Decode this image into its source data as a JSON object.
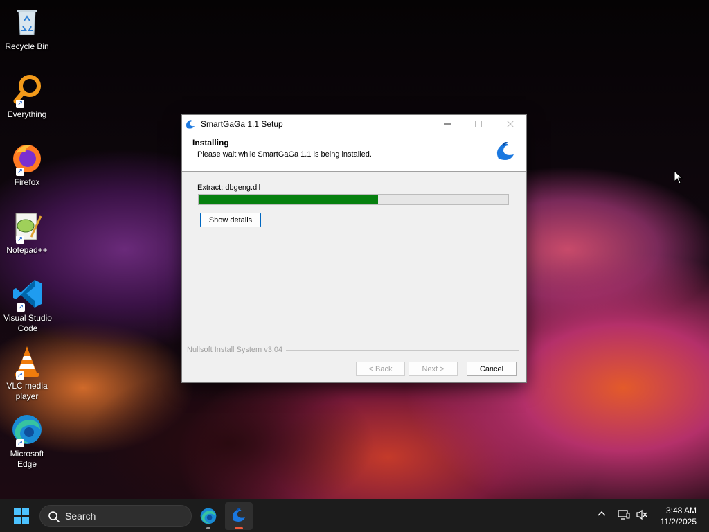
{
  "desktop": {
    "icons": [
      {
        "label": "Recycle Bin",
        "icon": "recycle-bin-icon"
      },
      {
        "label": "Everything",
        "icon": "everything-search-icon"
      },
      {
        "label": "Firefox",
        "icon": "firefox-icon"
      },
      {
        "label": "Notepad++",
        "icon": "notepad-plus-plus-icon"
      },
      {
        "label": "Visual Studio Code",
        "icon": "vscode-icon"
      },
      {
        "label": "VLC media player",
        "icon": "vlc-icon"
      },
      {
        "label": "Microsoft Edge",
        "icon": "edge-icon"
      }
    ]
  },
  "setup_window": {
    "title": "SmartGaGa 1.1 Setup",
    "header_title": "Installing",
    "header_subtitle": "Please wait while SmartGaGa 1.1 is being installed.",
    "status_text": "Extract: dbgeng.dll",
    "progress_percent": 58,
    "progress_color": "#06800f",
    "show_details_label": "Show details",
    "branding": "Nullsoft Install System v3.04",
    "back_label": "< Back",
    "next_label": "Next >",
    "cancel_label": "Cancel"
  },
  "taskbar": {
    "search_placeholder": "Search",
    "pinned": [
      {
        "name": "edge-icon"
      },
      {
        "name": "smartgaga-icon",
        "active": true
      }
    ],
    "time": "3:48 AM",
    "date": "11/2/2025",
    "accent": "#0078d4"
  }
}
